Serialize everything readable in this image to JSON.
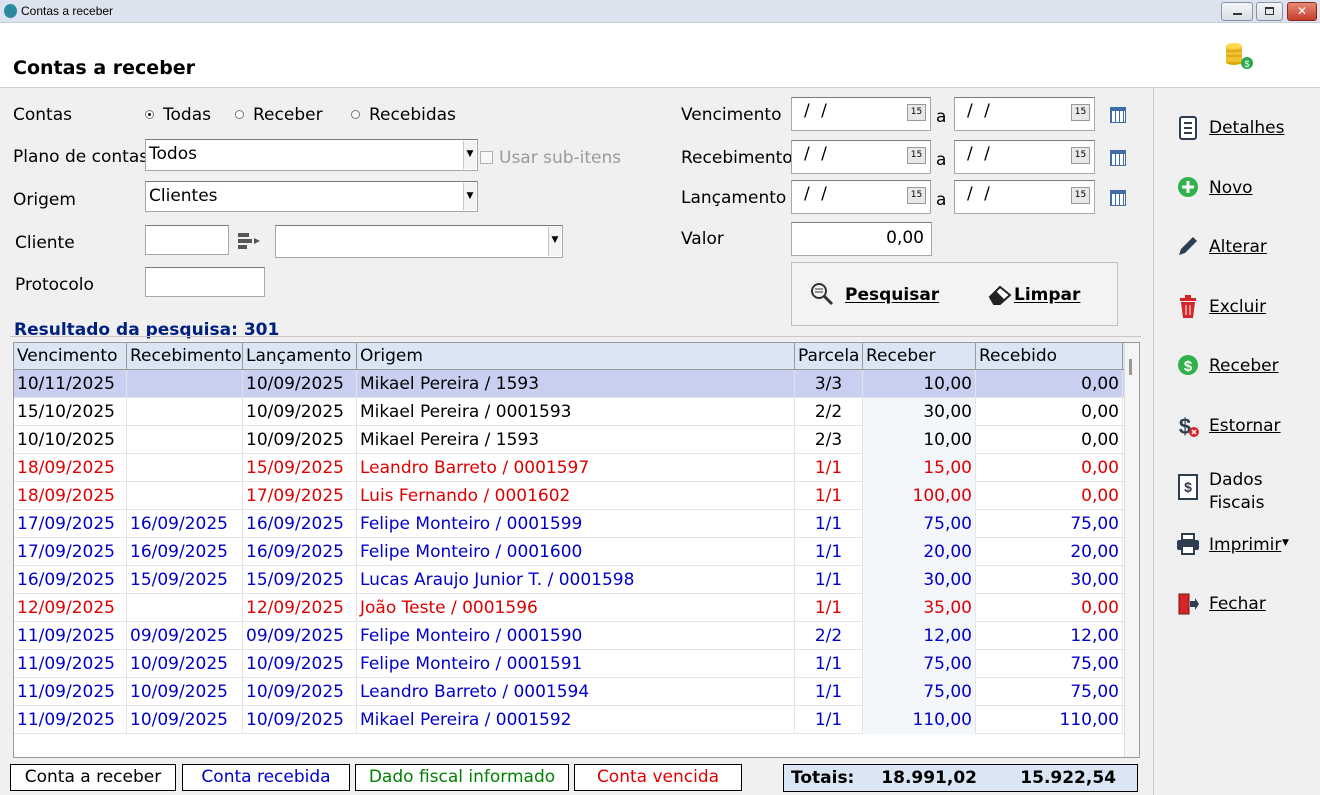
{
  "window": {
    "title": "Contas a receber"
  },
  "header": {
    "title": "Contas a receber"
  },
  "filters": {
    "contas_label": "Contas",
    "contas_options": [
      "Todas",
      "Receber",
      "Recebidas"
    ],
    "contas_selected": "Todas",
    "plano_label": "Plano de contas",
    "plano_value": "Todos",
    "usar_subitens_label": "Usar sub-itens",
    "origem_label": "Origem",
    "origem_value": "Clientes",
    "cliente_label": "Cliente",
    "cliente_code": "",
    "cliente_name": "",
    "protocolo_label": "Protocolo",
    "protocolo_value": "",
    "vencimento_label": "Vencimento",
    "recebimento_label": "Recebimento",
    "lancamento_label": "Lançamento",
    "date_empty": "/ /",
    "between": "a",
    "valor_label": "Valor",
    "valor_value": "0,00"
  },
  "actions": {
    "pesquisar": "Pesquisar",
    "limpar": "Limpar"
  },
  "sidebar": {
    "items": [
      {
        "label": "Detalhes",
        "icon": "document-icon"
      },
      {
        "label": "Novo",
        "icon": "plus-circle-icon"
      },
      {
        "label": "Alterar",
        "icon": "pencil-icon"
      },
      {
        "label": "Excluir",
        "icon": "trash-icon"
      },
      {
        "label": "Receber",
        "icon": "dollar-circle-icon"
      },
      {
        "label": "Estornar",
        "icon": "dollar-cancel-icon"
      },
      {
        "label": "Dados Fiscais",
        "icon": "receipt-icon"
      },
      {
        "label": "Imprimir",
        "icon": "printer-icon"
      },
      {
        "label": "Fechar",
        "icon": "exit-door-icon"
      }
    ]
  },
  "result": {
    "label": "Resultado da pesquisa: 301"
  },
  "table": {
    "columns": [
      "Vencimento",
      "Recebimento",
      "Lançamento",
      "Origem",
      "Parcela",
      "Receber",
      "Recebido"
    ],
    "rows": [
      {
        "vencimento": "10/11/2025",
        "recebimento": "",
        "lancamento": "10/09/2025",
        "origem": "Mikael Pereira / 1593",
        "parcela": "3/3",
        "receber": "10,00",
        "recebido": "0,00",
        "status": "a_receber"
      },
      {
        "vencimento": "15/10/2025",
        "recebimento": "",
        "lancamento": "10/09/2025",
        "origem": "Mikael Pereira / 0001593",
        "parcela": "2/2",
        "receber": "30,00",
        "recebido": "0,00",
        "status": "a_receber"
      },
      {
        "vencimento": "10/10/2025",
        "recebimento": "",
        "lancamento": "10/09/2025",
        "origem": "Mikael Pereira / 1593",
        "parcela": "2/3",
        "receber": "10,00",
        "recebido": "0,00",
        "status": "a_receber"
      },
      {
        "vencimento": "18/09/2025",
        "recebimento": "",
        "lancamento": "15/09/2025",
        "origem": "Leandro Barreto / 0001597",
        "parcela": "1/1",
        "receber": "15,00",
        "recebido": "0,00",
        "status": "vencida"
      },
      {
        "vencimento": "18/09/2025",
        "recebimento": "",
        "lancamento": "17/09/2025",
        "origem": "Luis Fernando  / 0001602",
        "parcela": "1/1",
        "receber": "100,00",
        "recebido": "0,00",
        "status": "vencida"
      },
      {
        "vencimento": "17/09/2025",
        "recebimento": "16/09/2025",
        "lancamento": "16/09/2025",
        "origem": "Felipe Monteiro / 0001599",
        "parcela": "1/1",
        "receber": "75,00",
        "recebido": "75,00",
        "status": "recebida"
      },
      {
        "vencimento": "17/09/2025",
        "recebimento": "16/09/2025",
        "lancamento": "16/09/2025",
        "origem": "Felipe Monteiro / 0001600",
        "parcela": "1/1",
        "receber": "20,00",
        "recebido": "20,00",
        "status": "recebida"
      },
      {
        "vencimento": "16/09/2025",
        "recebimento": "15/09/2025",
        "lancamento": "15/09/2025",
        "origem": "Lucas Araujo Junior T. / 0001598",
        "parcela": "1/1",
        "receber": "30,00",
        "recebido": "30,00",
        "status": "recebida"
      },
      {
        "vencimento": "12/09/2025",
        "recebimento": "",
        "lancamento": "12/09/2025",
        "origem": "João Teste / 0001596",
        "parcela": "1/1",
        "receber": "35,00",
        "recebido": "0,00",
        "status": "vencida"
      },
      {
        "vencimento": "11/09/2025",
        "recebimento": "09/09/2025",
        "lancamento": "09/09/2025",
        "origem": "Felipe Monteiro / 0001590",
        "parcela": "2/2",
        "receber": "12,00",
        "recebido": "12,00",
        "status": "recebida"
      },
      {
        "vencimento": "11/09/2025",
        "recebimento": "10/09/2025",
        "lancamento": "10/09/2025",
        "origem": "Felipe Monteiro / 0001591",
        "parcela": "1/1",
        "receber": "75,00",
        "recebido": "75,00",
        "status": "recebida"
      },
      {
        "vencimento": "11/09/2025",
        "recebimento": "10/09/2025",
        "lancamento": "10/09/2025",
        "origem": "Leandro Barreto / 0001594",
        "parcela": "1/1",
        "receber": "75,00",
        "recebido": "75,00",
        "status": "recebida"
      },
      {
        "vencimento": "11/09/2025",
        "recebimento": "10/09/2025",
        "lancamento": "10/09/2025",
        "origem": "Mikael Pereira / 0001592",
        "parcela": "1/1",
        "receber": "110,00",
        "recebido": "110,00",
        "status": "recebida"
      }
    ]
  },
  "legend": {
    "a_receber": "Conta a receber",
    "recebida": "Conta recebida",
    "fiscal": "Dado fiscal informado",
    "vencida": "Conta vencida"
  },
  "totals": {
    "label": "Totais:",
    "receber": "18.991,02",
    "recebido": "15.922,54"
  },
  "colors": {
    "a_receber": "#000000",
    "recebida": "#0000cc",
    "fiscal": "#008000",
    "vencida": "#e00000",
    "header_bg": "#dbe6f4",
    "selected_row": "#c9cff0",
    "result_title": "#002080"
  }
}
